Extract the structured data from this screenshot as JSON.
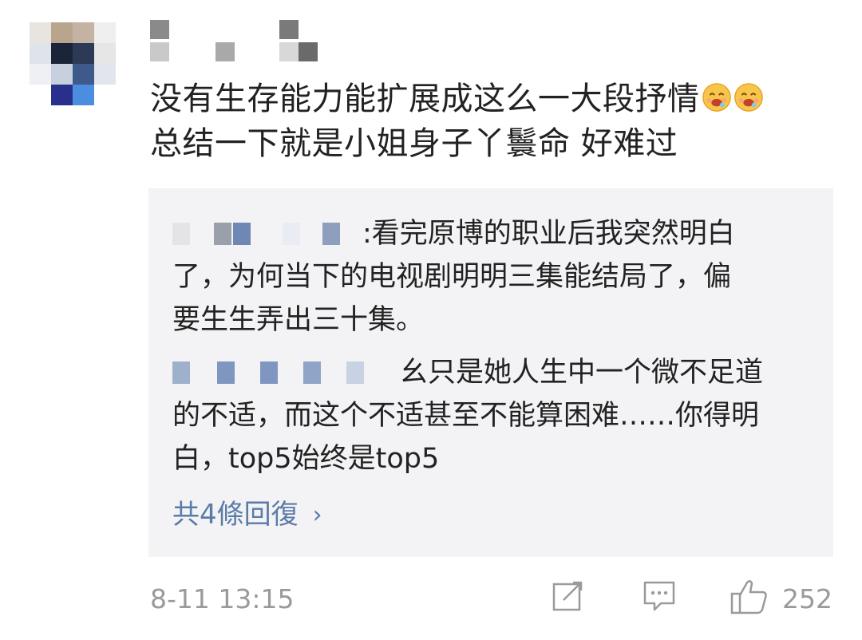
{
  "comment": {
    "line1": "没有生存能力能扩展成这么一大段抒情",
    "line2": "总结一下就是小姐身子丫鬟命  好难过",
    "emoji": "drooling-face-emoji"
  },
  "replies": [
    {
      "author_suffix": ":",
      "text_line1": "看完原博的职业后我突然明白",
      "text_line2": "了，为何当下的电视剧明明三集能结局了，偏",
      "text_line3": "要生生弄出三十集。"
    },
    {
      "text_line1": "幺只是她人生中一个微不足道",
      "text_line2": "的不适，而这个不适甚至不能算困难……你得明",
      "text_line3": "白，top5始终是top5"
    }
  ],
  "more_replies": {
    "label": "共4條回復",
    "chevron": "›"
  },
  "footer": {
    "timestamp": "8-11 13:15",
    "like_count": "252",
    "icons": [
      "share-icon",
      "comment-icon",
      "thumbs-up-icon"
    ]
  },
  "colors": {
    "link": "#5b7ba8",
    "meta": "#9a9a9a",
    "reply_bg": "#f3f3f5"
  }
}
